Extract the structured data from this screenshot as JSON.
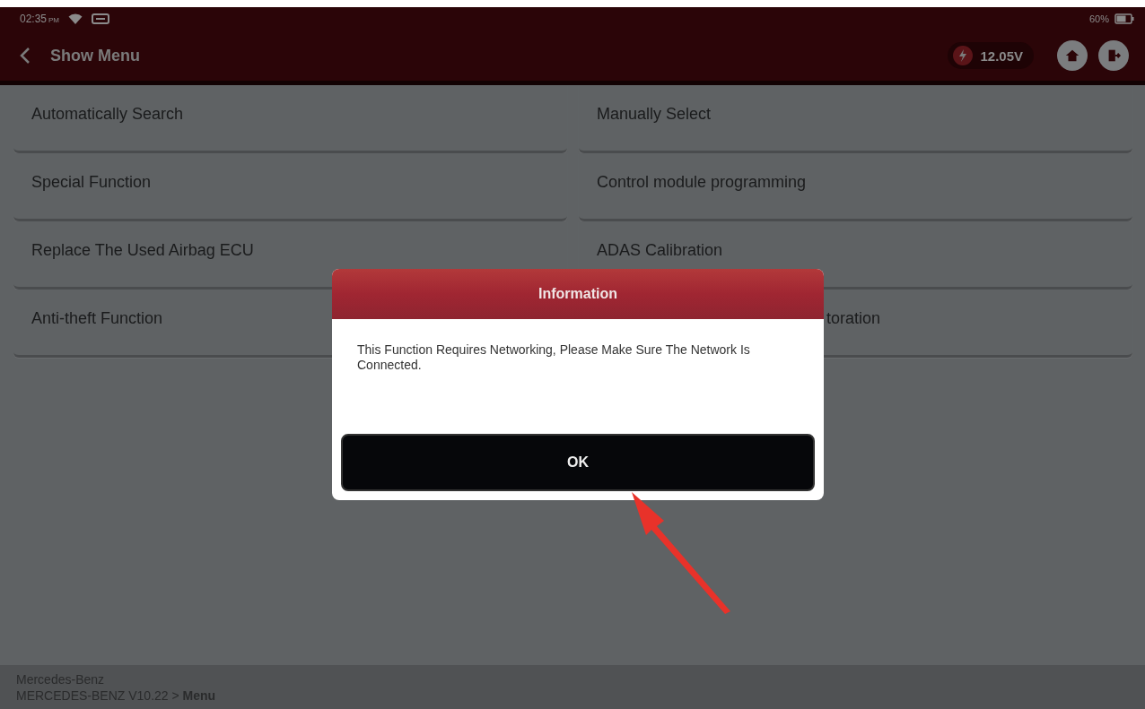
{
  "status_bar": {
    "time": "02:35",
    "meridiem": "PM",
    "battery": "60%"
  },
  "header": {
    "title": "Show Menu",
    "voltage": "12.05V"
  },
  "menu": [
    {
      "label": "Automatically Search",
      "covered": false
    },
    {
      "label": "Manually Select",
      "covered": false
    },
    {
      "label": "Special Function",
      "covered": false
    },
    {
      "label": "Control module programming",
      "covered": false
    },
    {
      "label": "Replace The Used Airbag ECU",
      "covered": false
    },
    {
      "label": "ADAS Calibration",
      "covered": false
    },
    {
      "label": "Anti-theft Function",
      "covered": false
    },
    {
      "label": "toration",
      "covered": true
    }
  ],
  "dialog": {
    "title": "Information",
    "message": "This Function Requires Networking, Please Make Sure The Network Is Connected.",
    "button": "OK"
  },
  "footer": {
    "vehicle": "Mercedes-Benz",
    "path": "MERCEDES-BENZ V10.22 > **Menu**"
  }
}
